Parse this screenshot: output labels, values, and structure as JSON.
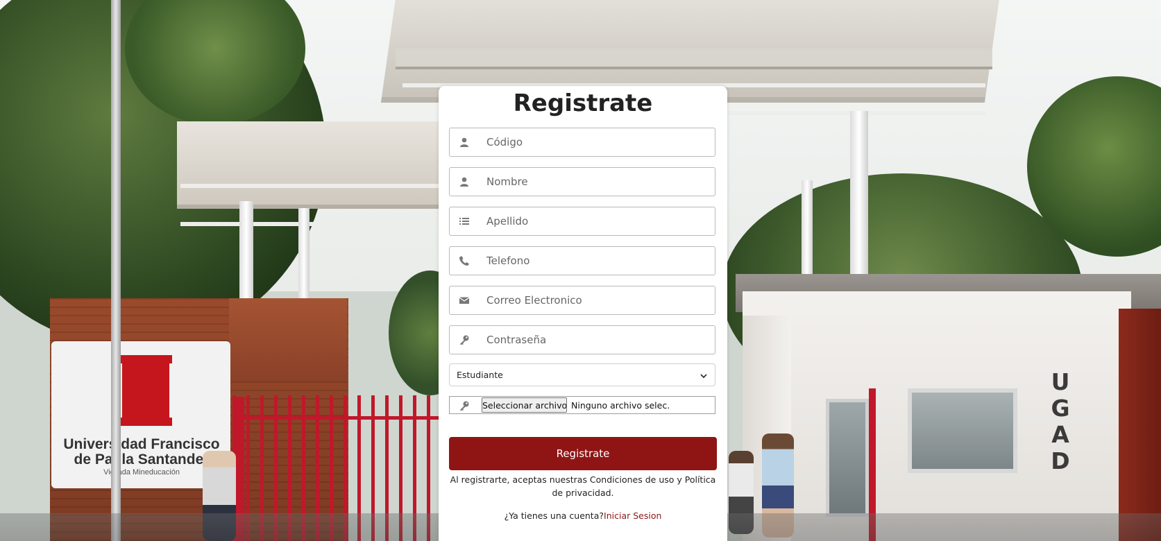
{
  "register": {
    "title": "Registrate",
    "fields": [
      {
        "placeholder": "Código",
        "icon": "user-icon"
      },
      {
        "placeholder": "Nombre",
        "icon": "user-icon"
      },
      {
        "placeholder": "Apellido",
        "icon": "list-icon"
      },
      {
        "placeholder": "Telefono",
        "icon": "phone-icon"
      },
      {
        "placeholder": "Correo Electronico",
        "icon": "envelope-icon"
      },
      {
        "placeholder": "Contraseña",
        "icon": "key-icon"
      }
    ],
    "role_select": {
      "value": "Estudiante"
    },
    "file_input": {
      "button_label": "Seleccionar archivo",
      "status": "Ninguno archivo selec."
    },
    "submit_label": "Registrate",
    "terms_text": "Al registrarte, aceptas nuestras Condiciones de uso y Política de privacidad.",
    "login_prompt": "¿Ya tienes una cuenta?",
    "login_link": "Iniciar Sesion"
  },
  "background": {
    "sign_line1": "Universidad Francisco",
    "sign_line2": "de Paula Santander",
    "sign_sub": "Vigilada Mineducación",
    "building_letters": "U G A D"
  },
  "colors": {
    "brand_red": "#8f1515",
    "card_bg": "#ffffff"
  }
}
